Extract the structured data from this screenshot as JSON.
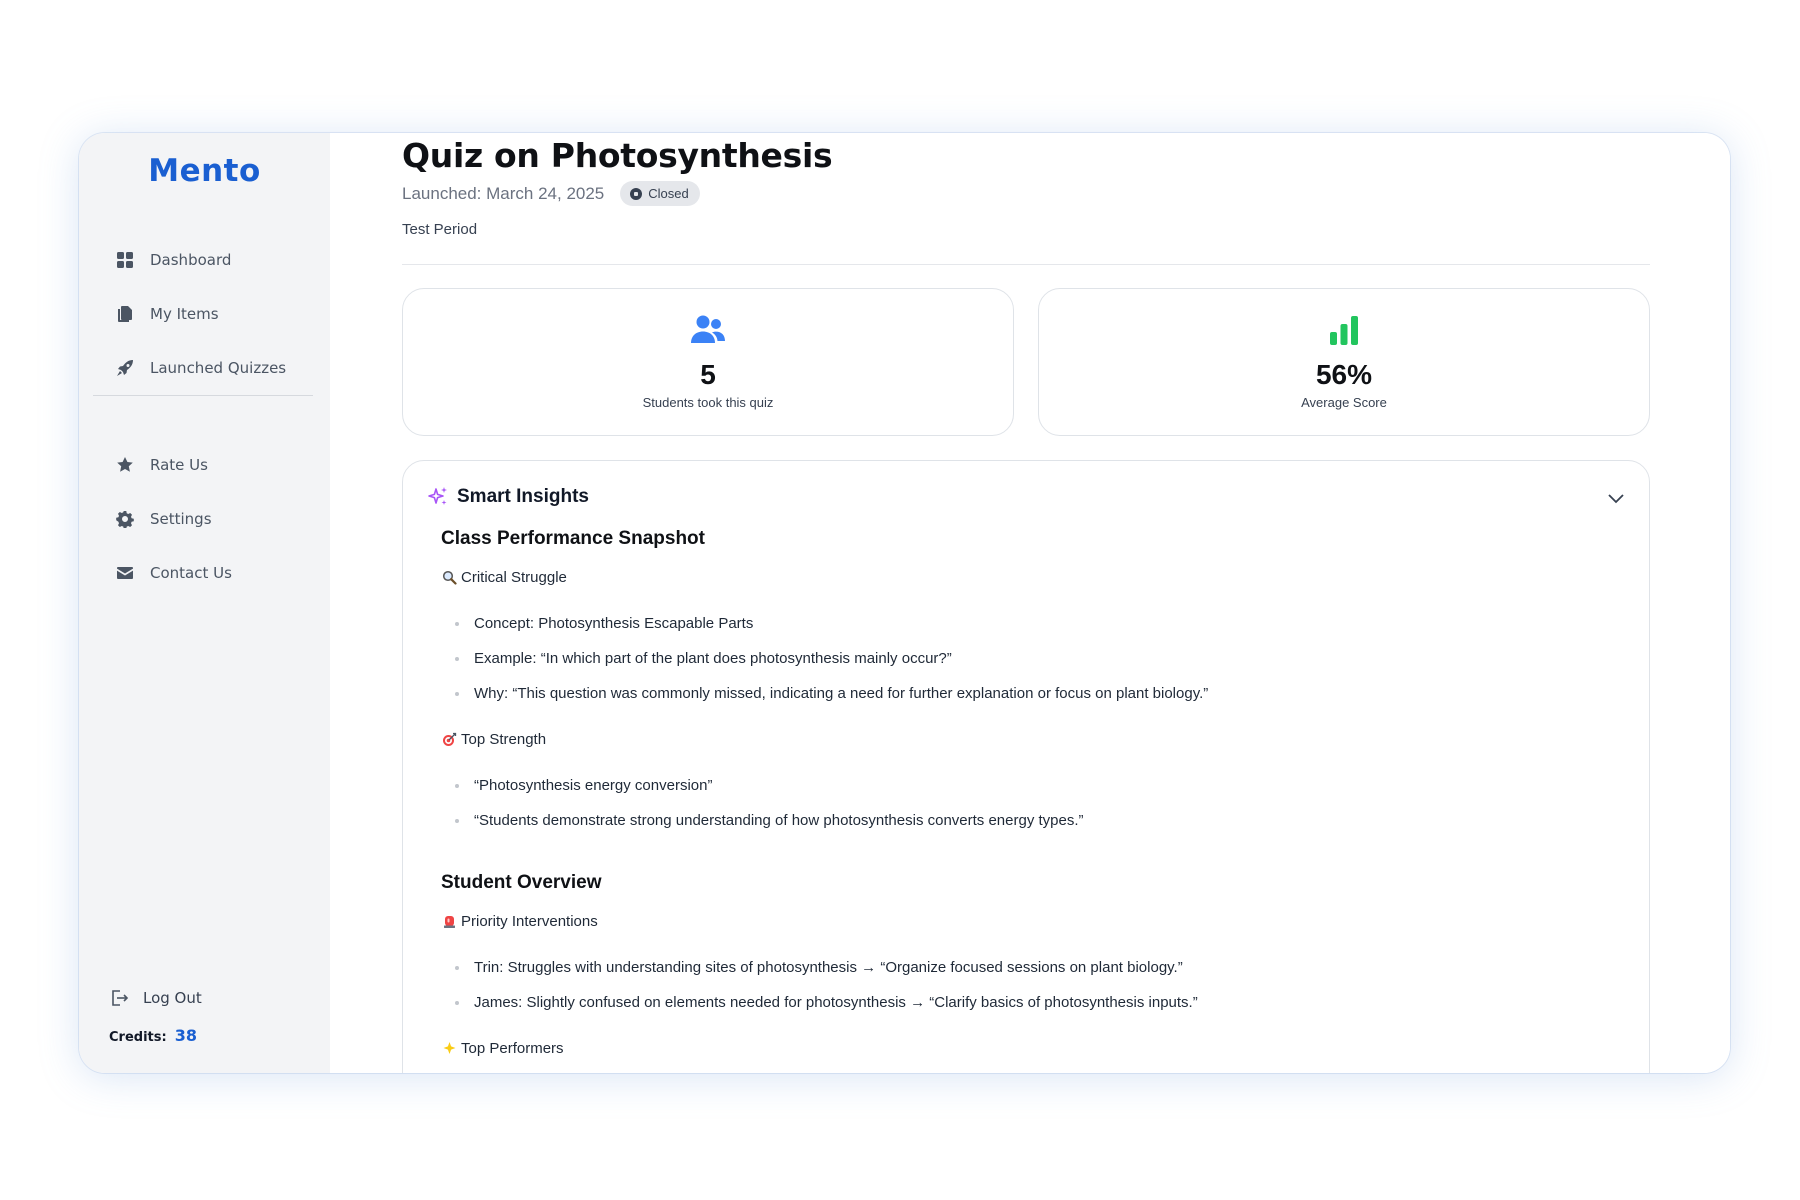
{
  "sidebar": {
    "logo": "Mento",
    "nav_primary": [
      {
        "label": "Dashboard",
        "icon": "grid-icon"
      },
      {
        "label": "My Items",
        "icon": "documents-icon"
      },
      {
        "label": "Launched Quizzes",
        "icon": "rocket-icon"
      }
    ],
    "nav_secondary": [
      {
        "label": "Rate Us",
        "icon": "star-icon"
      },
      {
        "label": "Settings",
        "icon": "gear-icon"
      },
      {
        "label": "Contact Us",
        "icon": "envelope-icon"
      }
    ],
    "logout_label": "Log Out",
    "credits_label": "Credits:",
    "credits_value": "38"
  },
  "header": {
    "title": "Quiz on Photosynthesis",
    "launched": "Launched: March 24, 2025",
    "status": "Closed",
    "period": "Test Period"
  },
  "stats": {
    "students": {
      "value": "5",
      "label": "Students took this quiz",
      "icon": "users-icon",
      "color": "#3b82f6"
    },
    "average": {
      "value": "56%",
      "label": "Average Score",
      "icon": "bar-chart-icon",
      "color": "#22c55e"
    }
  },
  "insights": {
    "title": "Smart Insights",
    "snapshot": {
      "heading": "Class Performance Snapshot",
      "critical": {
        "label": "Critical Struggle",
        "icon": "magnifier-icon",
        "items": [
          "Concept: Photosynthesis Escapable Parts",
          "Example: “In which part of the plant does photosynthesis mainly occur?”",
          "Why: “This question was commonly missed, indicating a need for further explanation or focus on plant biology.”"
        ]
      },
      "strength": {
        "label": "Top Strength",
        "icon": "target-icon",
        "items": [
          "“Photosynthesis energy conversion”",
          "“Students demonstrate strong understanding of how photosynthesis converts energy types.”"
        ]
      }
    },
    "overview": {
      "heading": "Student Overview",
      "priority": {
        "label": "Priority Interventions",
        "icon": "alarm-icon",
        "items": [
          "Trin: Struggles with understanding sites of photosynthesis → “Organize focused sessions on plant biology.”",
          "James: Slightly confused on elements needed for photosynthesis → “Clarify basics of photosynthesis inputs.”"
        ]
      },
      "top": {
        "label": "Top Performers",
        "icon": "sparkle-star-icon"
      }
    }
  },
  "colors": {
    "brand": "#1a5fd1",
    "sidebar_bg": "#f3f4f6",
    "insight_accent": "#a855f7"
  }
}
